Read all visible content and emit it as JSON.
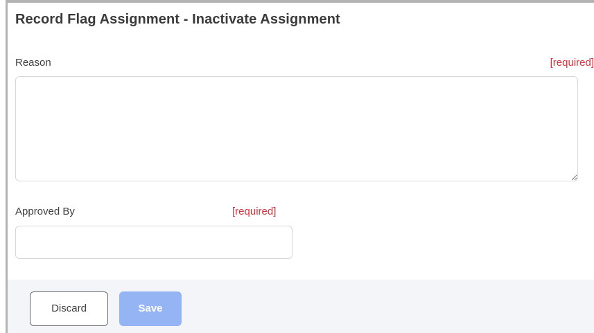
{
  "dialog": {
    "title": "Record Flag Assignment - Inactivate Assignment"
  },
  "form": {
    "reason": {
      "label": "Reason",
      "required_text": "[required]",
      "value": ""
    },
    "approved_by": {
      "label": "Approved By",
      "required_text": "[required]",
      "value": ""
    }
  },
  "footer": {
    "discard_label": "Discard",
    "save_label": "Save"
  },
  "colors": {
    "required": "#d2323c",
    "save_button": "#95b4f3",
    "footer_background": "#f4f5f8"
  }
}
